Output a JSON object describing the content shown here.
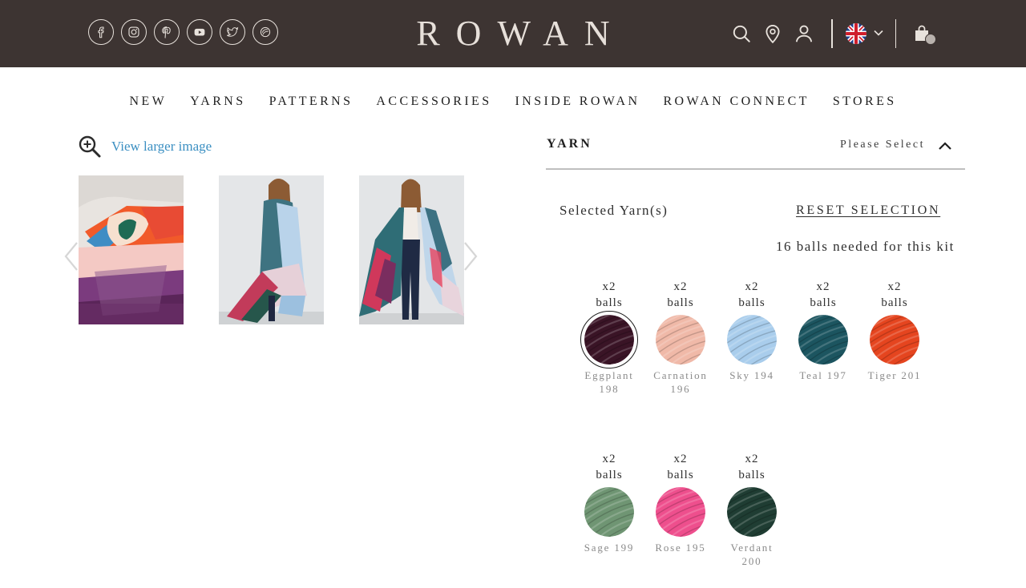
{
  "header": {
    "brand": "ROWAN",
    "social": [
      {
        "name": "facebook",
        "glyph": "f"
      },
      {
        "name": "instagram",
        "glyph": "ig"
      },
      {
        "name": "pinterest",
        "glyph": "p"
      },
      {
        "name": "youtube",
        "glyph": "yt"
      },
      {
        "name": "twitter",
        "glyph": "tw"
      },
      {
        "name": "ravelry",
        "glyph": "r"
      }
    ],
    "icons": [
      "search-icon",
      "store-locator-icon",
      "account-icon",
      "uk-flag-icon",
      "chevron-down-icon",
      "shopping-bag-icon"
    ]
  },
  "nav": {
    "items": [
      "NEW",
      "YARNS",
      "PATTERNS",
      "ACCESSORIES",
      "INSIDE ROWAN",
      "ROWAN CONNECT",
      "STORES"
    ]
  },
  "gallery": {
    "view_larger": "View larger image"
  },
  "yarn": {
    "title": "YARN",
    "select_label": "Please Select",
    "selected_label": "Selected Yarn(s)",
    "reset_label": "RESET SELECTION",
    "needed_text": "16 balls needed for this kit",
    "swatches": [
      {
        "qty": "x2",
        "unit": "balls",
        "name": "Eggplant",
        "code": "198",
        "color": "#3a1426",
        "selected": true
      },
      {
        "qty": "x2",
        "unit": "balls",
        "name": "Carnation",
        "code": "196",
        "color": "#f0b9a8",
        "selected": false
      },
      {
        "qty": "x2",
        "unit": "balls",
        "name": "Sky",
        "code": "194",
        "color": "#a9cdec",
        "selected": false
      },
      {
        "qty": "x2",
        "unit": "balls",
        "name": "Teal",
        "code": "197",
        "color": "#1c5560",
        "selected": false
      },
      {
        "qty": "x2",
        "unit": "balls",
        "name": "Tiger",
        "code": "201",
        "color": "#e5451f",
        "selected": false
      },
      {
        "qty": "x2",
        "unit": "balls",
        "name": "Sage",
        "code": "199",
        "color": "#6f9573",
        "selected": false
      },
      {
        "qty": "x2",
        "unit": "balls",
        "name": "Rose",
        "code": "195",
        "color": "#ee4f8d",
        "selected": false
      },
      {
        "qty": "x2",
        "unit": "balls",
        "name": "Verdant",
        "code": "200",
        "color": "#1f3d33",
        "selected": false
      }
    ]
  },
  "colors": {
    "header_bg": "#3d3432",
    "link_blue": "#3b8fc2",
    "header_fg": "#e7e0da"
  }
}
